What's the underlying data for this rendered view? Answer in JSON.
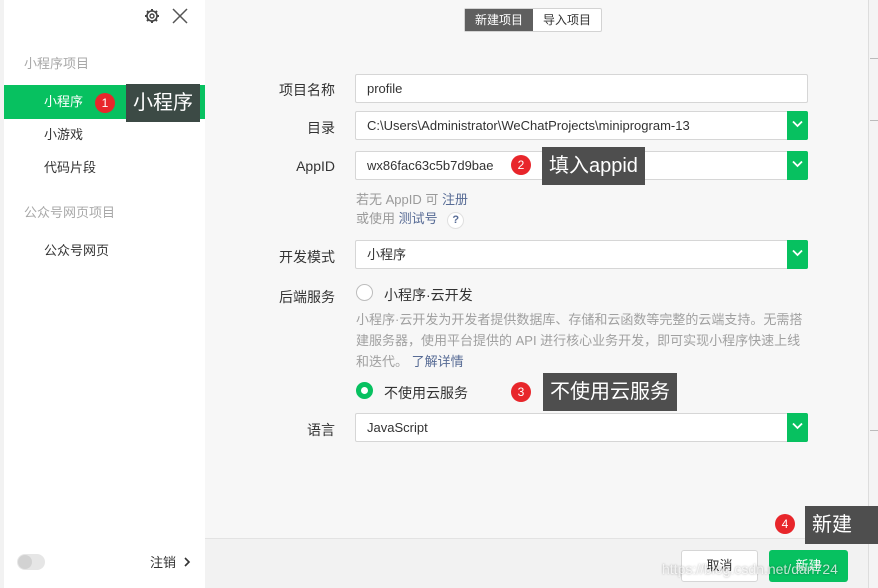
{
  "window": {
    "settings_icon": "gear-icon",
    "close_icon": "close-icon"
  },
  "sidebar": {
    "section_miniprogram": "小程序项目",
    "items": [
      {
        "label": "小程序",
        "active": true
      },
      {
        "label": "小游戏",
        "active": false
      },
      {
        "label": "代码片段",
        "active": false
      }
    ],
    "section_official": "公众号网页项目",
    "official_item": "公众号网页",
    "logout_label": "注销",
    "logout_icon": "chevron-right-icon"
  },
  "tabs": [
    {
      "label": "新建项目",
      "active": true
    },
    {
      "label": "导入项目",
      "active": false
    }
  ],
  "form": {
    "project_name": {
      "label": "项目名称",
      "value": "profile"
    },
    "directory": {
      "label": "目录",
      "value": "C:\\Users\\Administrator\\WeChatProjects\\miniprogram-13"
    },
    "appid": {
      "label": "AppID",
      "value": "wx86fac63c5b7d9bae"
    },
    "appid_hint_prefix": "若无 AppID 可",
    "appid_hint_link": "注册",
    "appid_test_prefix": "或使用",
    "appid_test_link": "测试号",
    "help_mark": "?",
    "dev_mode": {
      "label": "开发模式",
      "value": "小程序"
    },
    "backend": {
      "label": "后端服务",
      "option_cloud": "小程序·云开发",
      "cloud_desc": "小程序·云开发为开发者提供数据库、存储和云函数等完整的云端支持。无需搭建服务器，使用平台提供的 API 进行核心业务开发，即可实现小程序快速上线和迭代。",
      "cloud_desc_link": "了解详情",
      "option_no_cloud": "不使用云服务",
      "selected": "不使用云服务"
    },
    "language": {
      "label": "语言",
      "value": "JavaScript"
    }
  },
  "buttons": {
    "cancel": "取消",
    "create": "新建"
  },
  "annotations": [
    {
      "num": "1",
      "text": "小程序"
    },
    {
      "num": "2",
      "text": "填入appid"
    },
    {
      "num": "3",
      "text": "不使用云服务"
    },
    {
      "num": "4",
      "text": "新建"
    }
  ],
  "watermark": "https://blog.csdn.net/dan724",
  "colors": {
    "accent": "#07c160",
    "link": "#576b95",
    "badge": "#e8262b",
    "callout": "#4e4e4e"
  }
}
